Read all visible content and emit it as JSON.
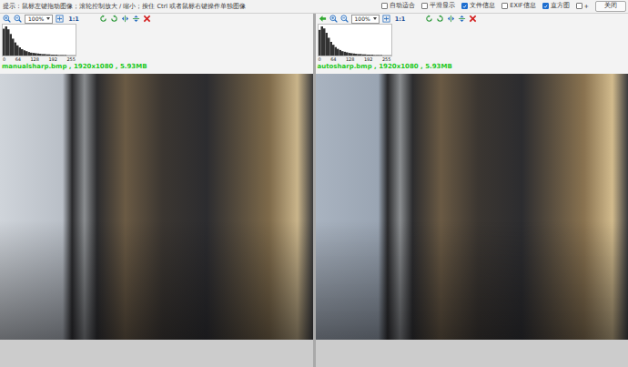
{
  "window": {
    "hint": "提示：鼠标左键拖动图像；滚轮控制放大 / 缩小；按住 Ctrl 或者鼠标右键操作单独图像"
  },
  "options": [
    {
      "label": "自动适合",
      "checked": false
    },
    {
      "label": "平滑显示",
      "checked": false
    },
    {
      "label": "文件信息",
      "checked": true
    },
    {
      "label": "EXIF信息",
      "checked": false
    },
    {
      "label": "直方图",
      "checked": true
    },
    {
      "label": "+",
      "checked": false
    }
  ],
  "close_button": "关闭",
  "panels": [
    {
      "swap_arrow": false,
      "zoom": "100%",
      "actual_size": "1:1",
      "file_info": "manualsharp.bmp , 1920x1080 , 5.93MB",
      "histogram": {
        "ticks": [
          "0",
          "64",
          "128",
          "192",
          "255"
        ],
        "values": [
          92,
          100,
          90,
          74,
          58,
          45,
          35,
          28,
          22,
          18,
          15,
          12,
          10,
          9,
          8,
          7,
          6,
          5,
          5,
          4,
          4,
          3,
          3,
          3,
          2,
          2,
          2,
          2,
          1,
          1,
          1,
          1
        ]
      }
    },
    {
      "swap_arrow": true,
      "zoom": "100%",
      "actual_size": "1:1",
      "file_info": "autosharp.bmp , 1920x1080 , 5.93MB",
      "histogram": {
        "ticks": [
          "0",
          "64",
          "128",
          "192",
          "255"
        ],
        "values": [
          88,
          100,
          93,
          78,
          61,
          47,
          37,
          29,
          23,
          19,
          15,
          13,
          11,
          9,
          8,
          7,
          6,
          5,
          5,
          4,
          4,
          3,
          3,
          3,
          2,
          2,
          2,
          2,
          1,
          1,
          1,
          1
        ]
      }
    }
  ]
}
